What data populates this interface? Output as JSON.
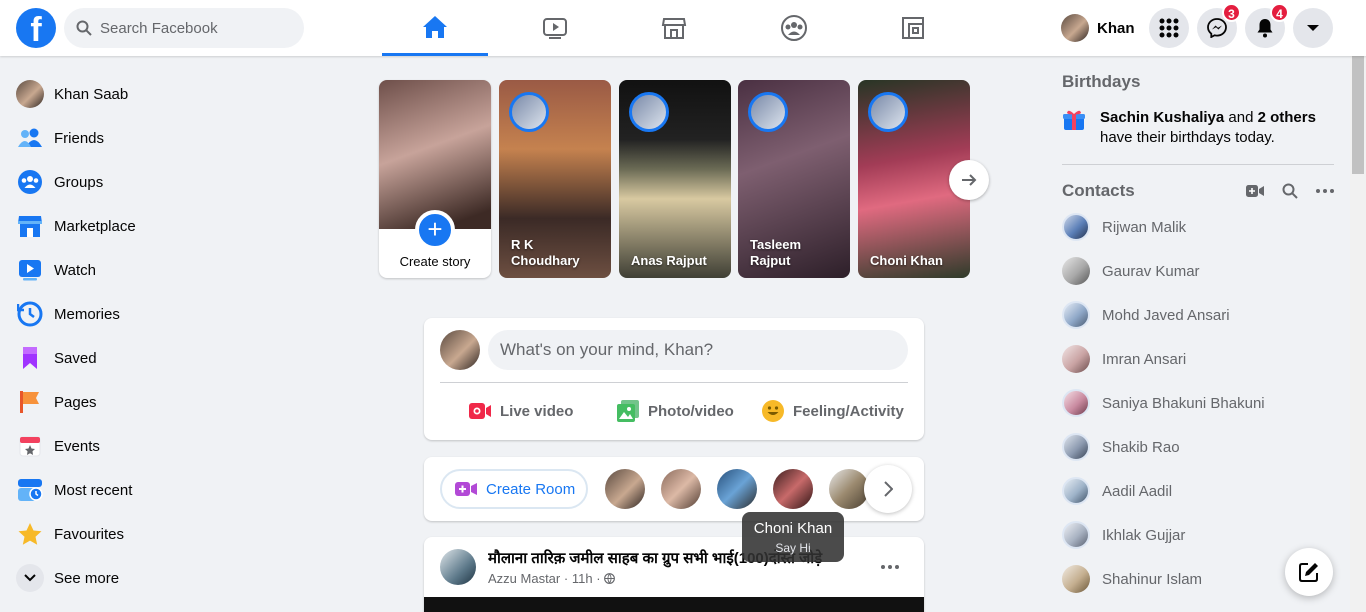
{
  "header": {
    "logo": "f",
    "search_placeholder": "Search Facebook",
    "user_name": "Khan",
    "messenger_count": "3",
    "notifications_count": "4",
    "accent": "#1877f2"
  },
  "nav_tabs": [
    {
      "name": "home",
      "icon": "home-icon",
      "active": true
    },
    {
      "name": "watch",
      "icon": "video-icon",
      "active": false
    },
    {
      "name": "marketplace",
      "icon": "store-icon",
      "active": false
    },
    {
      "name": "groups",
      "icon": "groups-icon",
      "active": false
    },
    {
      "name": "gaming",
      "icon": "gaming-icon",
      "active": false
    }
  ],
  "sidebar": {
    "items": [
      {
        "label": "Khan Saab",
        "icon": "avatar"
      },
      {
        "label": "Friends",
        "icon": "friends-icon"
      },
      {
        "label": "Groups",
        "icon": "groups-icon"
      },
      {
        "label": "Marketplace",
        "icon": "marketplace-icon"
      },
      {
        "label": "Watch",
        "icon": "watch-icon"
      },
      {
        "label": "Memories",
        "icon": "memories-icon"
      },
      {
        "label": "Saved",
        "icon": "saved-icon"
      },
      {
        "label": "Pages",
        "icon": "pages-icon"
      },
      {
        "label": "Events",
        "icon": "events-icon"
      },
      {
        "label": "Most recent",
        "icon": "most-recent-icon"
      },
      {
        "label": "Favourites",
        "icon": "favourites-icon"
      },
      {
        "label": "See more",
        "icon": "chevron-down-icon"
      }
    ]
  },
  "stories": {
    "create_label": "Create story",
    "items": [
      {
        "name": "R K Choudhary"
      },
      {
        "name": "Anas Rajput"
      },
      {
        "name": "Tasleem Rajput"
      },
      {
        "name": "Choni Khan"
      }
    ]
  },
  "composer": {
    "placeholder": "What's on your mind, Khan?",
    "actions": [
      "Live video",
      "Photo/video",
      "Feeling/Activity"
    ]
  },
  "rooms": {
    "create_label": "Create Room",
    "tooltip_name": "Choni Khan",
    "tooltip_sub": "Say Hi"
  },
  "post": {
    "title": "मौलाना तारिक़ जमील साहब का ग्रुप सभी भाई(100)दोस्त जोड़े",
    "author": "Azzu Mastar",
    "time": "11h",
    "separator": "·"
  },
  "birthdays": {
    "title": "Birthdays",
    "name": "Sachin Kushaliya",
    "and": "and",
    "others": "2 others",
    "suffix": "have their birthdays today."
  },
  "contacts": {
    "title": "Contacts",
    "items": [
      "Rijwan Malik",
      "Gaurav Kumar",
      "Mohd Javed Ansari",
      "Imran Ansari",
      "Saniya Bhakuni Bhakuni",
      "Shakib Rao",
      "Aadil Aadil",
      "Ikhlak Gujjar",
      "Shahinur Islam"
    ]
  }
}
